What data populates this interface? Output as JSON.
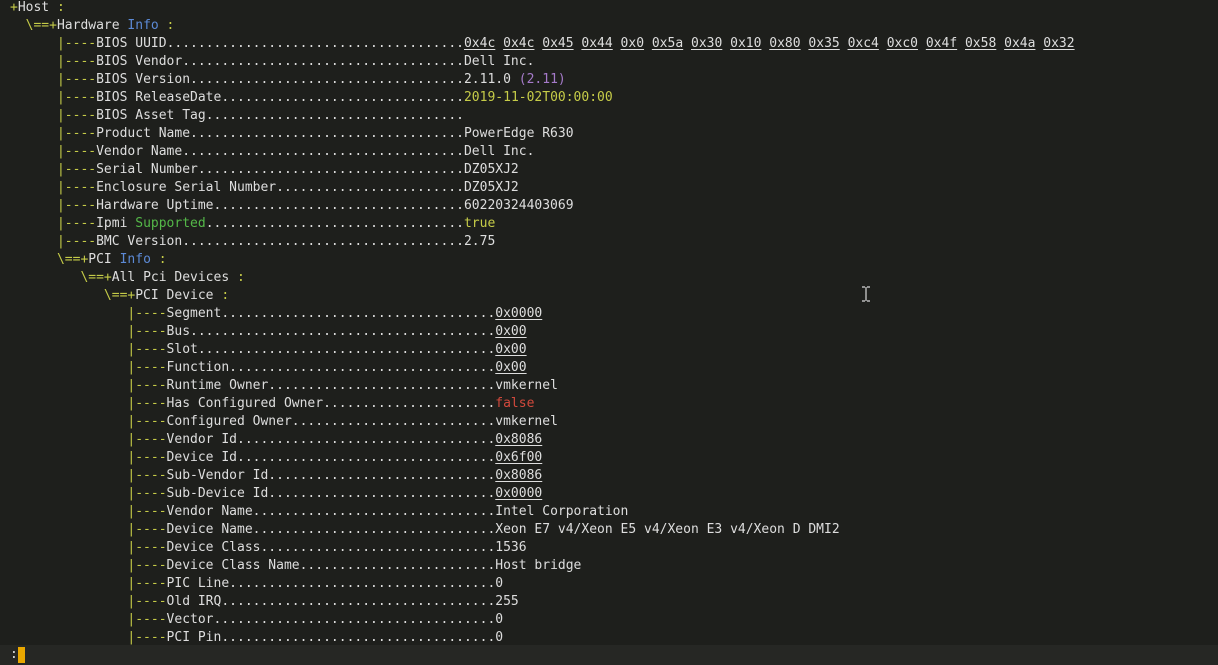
{
  "colors": {
    "background": "#1e1f1c",
    "text": "#dedede",
    "tree_branch": "#c6cc48",
    "info_word": "#5c8ad6",
    "supported_word": "#54b848",
    "version_paren": "#a57ac9",
    "date_value": "#c6cc48",
    "true_value": "#c6cc48",
    "false_value": "#d2493c",
    "status_cursor": "#e9a700"
  },
  "lines": [
    {
      "prefix": "",
      "branch": "+",
      "label": "Host",
      "post": " :",
      "kind": "hdr"
    },
    {
      "prefix": "  ",
      "branch": "\\==+",
      "label": "Hardware",
      "infoword": "Info",
      "post": " :",
      "kind": "hdr"
    },
    {
      "prefix": "      ",
      "branch": "|----",
      "label": "BIOS UUID",
      "dots": "......................................",
      "value": [
        "0x4c",
        "0x4c",
        "0x45",
        "0x44",
        "0x0",
        "0x5a",
        "0x30",
        "0x10",
        "0x80",
        "0x35",
        "0xc4",
        "0xc0",
        "0x4f",
        "0x58",
        "0x4a",
        "0x32"
      ],
      "vstyle": "uuid",
      "kind": "row"
    },
    {
      "prefix": "      ",
      "branch": "|----",
      "label": "BIOS Vendor",
      "dots": "....................................",
      "value": "Dell Inc.",
      "vstyle": "plain",
      "kind": "row"
    },
    {
      "prefix": "      ",
      "branch": "|----",
      "label": "BIOS Version",
      "dots": "...................................",
      "value": "2.11.0",
      "paren": "(2.11)",
      "vstyle": "version",
      "kind": "row"
    },
    {
      "prefix": "      ",
      "branch": "|----",
      "label": "BIOS ReleaseDate",
      "dots": "...............................",
      "value": "2019-11-02T00:00:00",
      "vstyle": "date",
      "kind": "row"
    },
    {
      "prefix": "      ",
      "branch": "|----",
      "label": "BIOS Asset Tag",
      "dots": ".................................",
      "value": "",
      "vstyle": "plain",
      "kind": "row"
    },
    {
      "prefix": "      ",
      "branch": "|----",
      "label": "Product Name",
      "dots": "...................................",
      "value": "PowerEdge R630",
      "vstyle": "plain",
      "kind": "row"
    },
    {
      "prefix": "      ",
      "branch": "|----",
      "label": "Vendor Name",
      "dots": "....................................",
      "value": "Dell Inc.",
      "vstyle": "plain",
      "kind": "row"
    },
    {
      "prefix": "      ",
      "branch": "|----",
      "label": "Serial Number",
      "dots": "..................................",
      "value": "DZ05XJ2",
      "vstyle": "plain",
      "kind": "row"
    },
    {
      "prefix": "      ",
      "branch": "|----",
      "label": "Enclosure Serial Number",
      "dots": "........................",
      "value": "DZ05XJ2",
      "vstyle": "plain",
      "kind": "row"
    },
    {
      "prefix": "      ",
      "branch": "|----",
      "label": "Hardware Uptime",
      "dots": "................................",
      "value": "60220324403069",
      "vstyle": "plain",
      "kind": "row"
    },
    {
      "prefix": "      ",
      "branch": "|----",
      "label": "Ipmi",
      "labelgreen": "Supported",
      "dots": ".................................",
      "value": "true",
      "vstyle": "true",
      "kind": "row"
    },
    {
      "prefix": "      ",
      "branch": "|----",
      "label": "BMC Version",
      "dots": "....................................",
      "value": "2.75",
      "vstyle": "plain",
      "kind": "row"
    },
    {
      "prefix": "      ",
      "branch": "\\==+",
      "label": "PCI",
      "infoword": "Info",
      "post": " :",
      "kind": "hdr"
    },
    {
      "prefix": "         ",
      "branch": "\\==+",
      "label": "All Pci Devices",
      "post": " :",
      "kind": "hdr"
    },
    {
      "prefix": "            ",
      "branch": "\\==+",
      "label": "PCI Device",
      "post": " :",
      "kind": "hdr"
    },
    {
      "prefix": "               ",
      "branch": "|----",
      "label": "Segment",
      "dots": "...................................",
      "value": "0x0000",
      "vstyle": "hex",
      "kind": "row"
    },
    {
      "prefix": "               ",
      "branch": "|----",
      "label": "Bus",
      "dots": ".......................................",
      "value": "0x00",
      "vstyle": "hex",
      "kind": "row"
    },
    {
      "prefix": "               ",
      "branch": "|----",
      "label": "Slot",
      "dots": "......................................",
      "value": "0x00",
      "vstyle": "hex",
      "kind": "row"
    },
    {
      "prefix": "               ",
      "branch": "|----",
      "label": "Function",
      "dots": "..................................",
      "value": "0x00",
      "vstyle": "hex",
      "kind": "row"
    },
    {
      "prefix": "               ",
      "branch": "|----",
      "label": "Runtime Owner",
      "dots": ".............................",
      "value": "vmkernel",
      "vstyle": "plain",
      "kind": "row"
    },
    {
      "prefix": "               ",
      "branch": "|----",
      "label": "Has Configured Owner",
      "dots": "......................",
      "value": "false",
      "vstyle": "false",
      "kind": "row"
    },
    {
      "prefix": "               ",
      "branch": "|----",
      "label": "Configured Owner",
      "dots": "..........................",
      "value": "vmkernel",
      "vstyle": "plain",
      "kind": "row"
    },
    {
      "prefix": "               ",
      "branch": "|----",
      "label": "Vendor Id",
      "dots": ".................................",
      "value": "0x8086",
      "vstyle": "hex",
      "kind": "row"
    },
    {
      "prefix": "               ",
      "branch": "|----",
      "label": "Device Id",
      "dots": ".................................",
      "value": "0x6f00",
      "vstyle": "hex",
      "kind": "row"
    },
    {
      "prefix": "               ",
      "branch": "|----",
      "label": "Sub-Vendor Id",
      "dots": ".............................",
      "value": "0x8086",
      "vstyle": "hex",
      "kind": "row"
    },
    {
      "prefix": "               ",
      "branch": "|----",
      "label": "Sub-Device Id",
      "dots": ".............................",
      "value": "0x0000",
      "vstyle": "hex",
      "kind": "row"
    },
    {
      "prefix": "               ",
      "branch": "|----",
      "label": "Vendor Name",
      "dots": "...............................",
      "value": "Intel Corporation",
      "vstyle": "plain",
      "kind": "row"
    },
    {
      "prefix": "               ",
      "branch": "|----",
      "label": "Device Name",
      "dots": "...............................",
      "value": "Xeon E7 v4/Xeon E5 v4/Xeon E3 v4/Xeon D DMI2",
      "vstyle": "plain",
      "kind": "row"
    },
    {
      "prefix": "               ",
      "branch": "|----",
      "label": "Device Class",
      "dots": "..............................",
      "value": "1536",
      "vstyle": "plain",
      "kind": "row"
    },
    {
      "prefix": "               ",
      "branch": "|----",
      "label": "Device Class Name",
      "dots": ".........................",
      "value": "Host bridge",
      "vstyle": "plain",
      "kind": "row"
    },
    {
      "prefix": "               ",
      "branch": "|----",
      "label": "PIC Line",
      "dots": "..................................",
      "value": "0",
      "vstyle": "plain",
      "kind": "row"
    },
    {
      "prefix": "               ",
      "branch": "|----",
      "label": "Old IRQ",
      "dots": "...................................",
      "value": "255",
      "vstyle": "plain",
      "kind": "row"
    },
    {
      "prefix": "               ",
      "branch": "|----",
      "label": "Vector",
      "dots": "....................................",
      "value": "0",
      "vstyle": "plain",
      "kind": "row"
    },
    {
      "prefix": "               ",
      "branch": "|----",
      "label": "PCI Pin",
      "dots": "...................................",
      "value": "0",
      "vstyle": "plain",
      "kind": "row"
    }
  ],
  "statusbar": {
    "prompt": ":"
  }
}
